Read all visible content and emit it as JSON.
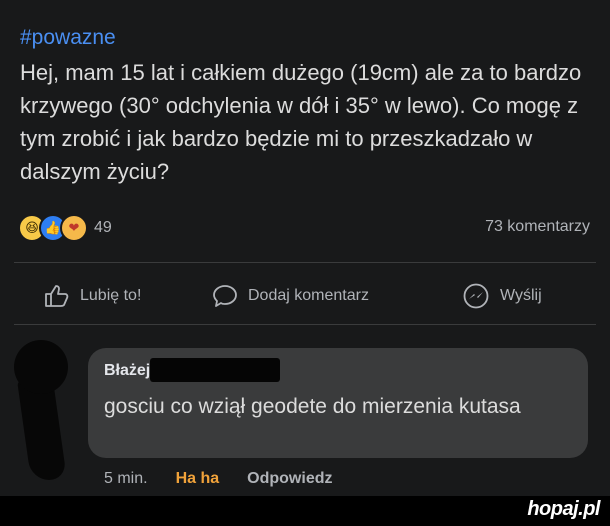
{
  "post": {
    "hashtag": "#powazne",
    "text": "Hej, mam 15 lat i całkiem dużego (19cm) ale za to bardzo krzywego (30° odchylenia w dół i 35° w lewo). Co mogę z tym zrobić i jak bardzo będzie mi to przeszkadzało w dalszym życiu?",
    "reactions": {
      "icons": [
        "haha-icon",
        "like-icon",
        "care-icon"
      ],
      "count": "49"
    },
    "comments_count": "73 komentarzy"
  },
  "actions": {
    "like_label": "Lubię to!",
    "comment_label": "Dodaj komentarz",
    "send_label": "Wyślij"
  },
  "comment": {
    "author": "Błażej",
    "text": "gosciu co wziął geodete do mierzenia kutasa",
    "time": "5 min.",
    "reaction": "Ha ha",
    "reply_label": "Odpowiedz"
  },
  "watermark": "hopaj.pl",
  "colors": {
    "background": "#18191a",
    "hashtag": "#4a8ff2",
    "bubble": "#3a3b3c",
    "haha_reaction": "#f0a23a"
  }
}
